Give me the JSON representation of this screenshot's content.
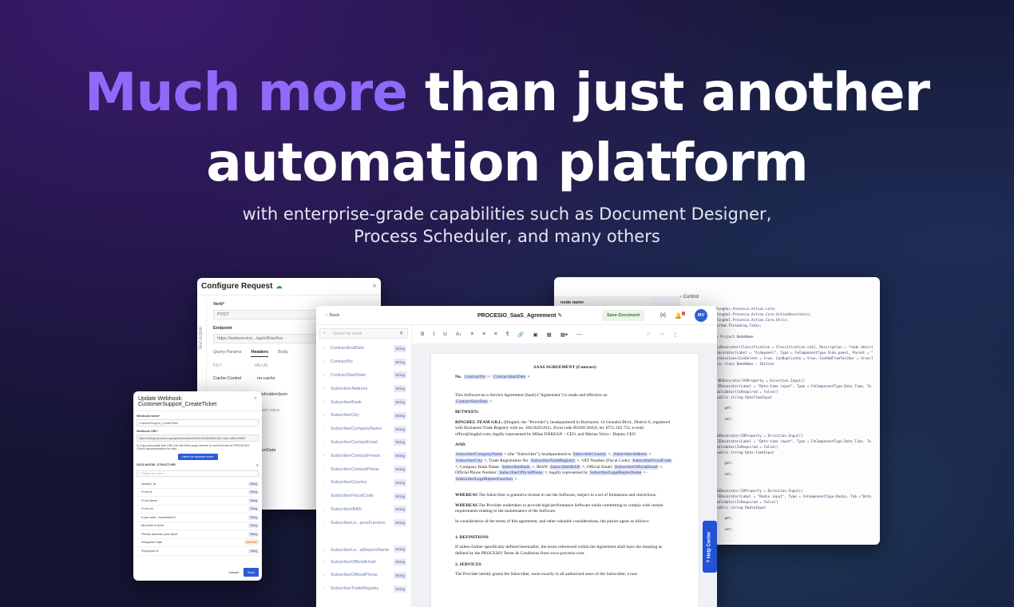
{
  "hero": {
    "headline_accent": "Much more",
    "headline_rest": " than just another",
    "headline_line2": "automation platform",
    "sub_line1": "with enterprise-grade capabilities such as Document Designer,",
    "sub_line2": "Process Scheduler, and many others"
  },
  "colors": {
    "accent": "#8f6af8",
    "primary_button": "#2a5bd7",
    "background": "#141532"
  },
  "configure_request": {
    "title": "Configure Request",
    "close": "×",
    "side_label": "Test Action",
    "verb_label": "Verb*",
    "verb_value": "POST",
    "endpoint_label": "Endpoint",
    "endpoint_value": "https://webservice.../api/v8/ws/tva",
    "tabs": [
      "Query Params",
      "Headers",
      "Body"
    ],
    "col_key": "KEY",
    "col_value": "VALUE",
    "rows": [
      {
        "key": "Cache-Control",
        "value": "no-cache"
      },
      {
        "key": "",
        "value": "application/json"
      },
      {
        "key": "",
        "value": "Insert value"
      },
      {
        "key": "",
        "value": "ationDate"
      }
    ]
  },
  "webhook": {
    "title": "Update Webhook: CustomerSupport_CreateTicket",
    "close": "×",
    "name_label": "Webhook name*",
    "name_value": "CustomerSupport_CreateTicket",
    "url_label": "Webhook URL*",
    "url_value": "https://webapi.procesio.app/api/webhooks/client/b7bc28f1f5d9-f4d1-4a4c-b8bd-f2ffd87",
    "note": "Copy and paste this URL into the third-party service to send events to PROCESIO. Check documentation for help",
    "listen_button": "Listen for another event",
    "structure_label": "DATA MODEL STRUCTURE",
    "search_placeholder": "Search by name",
    "fields": [
      {
        "name": "created_at",
        "type": "String"
      },
      {
        "name": "From Id",
        "type": "String"
      },
      {
        "name": "From Name",
        "type": "String"
      },
      {
        "name": "From Url",
        "type": "String"
      },
      {
        "name": "If you want...experiment it",
        "type": "String"
      },
      {
        "name": "My ticket is done",
        "type": "String"
      },
      {
        "name": "Please describe your ticket",
        "type": "String"
      },
      {
        "name": "Response Date",
        "type": "DateTime"
      },
      {
        "name": "Response Id",
        "type": "String"
      }
    ],
    "cancel": "Cancel",
    "save": "Save"
  },
  "code_window": {
    "control_tab": "Control",
    "node_name_header": "node name",
    "lines": [
      "Ringhel.Procesio.Action.Core;",
      "Ringhel.Procesio.Action.Core.ActionDecorators;",
      "Ringhel.Procesio.Action.Core.Utils;",
      "ystem.Threading.Tasks;",
      "",
      "e Project.NodeName",
      "",
      "ssDecorator(Classification = Classification.cat1, Description = \"node descri",
      "Decorator(Label = \"Sidepanel\", Type = FeComponentType.Side_panel, Parent = \"",
      "ermissions(CanDelete = true, CanDuplicate = true, CanAddFromToolbar = true)]",
      "lic class NodeName : IAction",
      "",
      "",
      "FBEDecorator(IOProperty = Direction.Input)]",
      "FEDecorator(Label = \"Date-time input\", Type = FeComponentType.Date_Time, Ta",
      "Validator(IsRequired = false)]",
      "public string DateTimeInput",
      "",
      "    get;",
      "",
      "    set;",
      "",
      "",
      "BEDecorator(IOProperty = Direction.Input)]",
      "FEDecorator(Label = \"Date-time input\", Type = FeComponentType.Date_Time, Ta",
      "Validator(IsRequired = false)]",
      "public string Date-timeInput",
      "",
      "    get;",
      "",
      "    set;",
      "",
      "",
      "BEDecorator(IOProperty = Direction.Input)]",
      "FEDecorator(Label = \"Radio input\", Type = FeComponentType.Radio, Tab =\"Deta",
      "Validator(IsRequired = false)]",
      "public string RadioInput",
      "",
      "    get;",
      "",
      "    set;"
    ]
  },
  "help_center": "Help Center",
  "document": {
    "back": "Back",
    "name": "PROCESIO_SaaS_Agreement",
    "save": "Save Document",
    "fx": "{x}",
    "badge": "1",
    "avatar": "MV",
    "search_placeholder": "Search by name",
    "variables": [
      {
        "name": "ContractEndDate",
        "type": "String"
      },
      {
        "name": "ContractNo",
        "type": "String"
      },
      {
        "name": "ContractStartDate",
        "type": "String"
      },
      {
        "name": "SubscriberAddress",
        "type": "String"
      },
      {
        "name": "SubscriberBank",
        "type": "String"
      },
      {
        "name": "SubscriberCity",
        "type": "String"
      },
      {
        "name": "SubscriberCompanyName",
        "type": "String"
      },
      {
        "name": "SubscriberContactEmail",
        "type": "String"
      },
      {
        "name": "SubscriberContactPerson",
        "type": "String"
      },
      {
        "name": "SubscriberContactPhone",
        "type": "String"
      },
      {
        "name": "SubscriberCountry",
        "type": "String"
      },
      {
        "name": "SubscriberFiscalCode",
        "type": "String"
      },
      {
        "name": "SubscriberIBAN",
        "type": "String"
      },
      {
        "name": "SubscriberLe...presFunction",
        "type": "String"
      },
      {
        "name": "SubscriberLe...alRepresName",
        "type": "String"
      },
      {
        "name": "SubscriberOfficialEmail",
        "type": "String"
      },
      {
        "name": "SubscriberOfficialPhone",
        "type": "String"
      },
      {
        "name": "SubscriberTradeRegistry",
        "type": "String"
      }
    ],
    "toolbar": [
      "B",
      "I",
      "U",
      "A↕",
      "≡",
      "≡",
      "≡",
      "¶",
      "🔗",
      "▣",
      "▦",
      "▦▾",
      "—",
      "↶",
      "↷",
      "⋮"
    ],
    "paper": {
      "heading": "SAAS AGREEMENT (Contract)",
      "no_label": "No.",
      "chip_contract_no": "ContractNo",
      "chip_start": "ContractStartDate",
      "intro": "This Software-as-a-Service Agreement (SaaS) (\"Agreement\") is made and effective on",
      "between": "BETWEEN:",
      "ringhel_bold": "RINGHEL TEAM S.R.L.",
      "ringhel_text": " (Ringhel, the \"Provider\"), headquartered in Bucharest, 14 Gentalui Blvd., District 6, registered with Bucharest Trade Registry with no. J40/2629/2011, fiscal code RO28139450, tel. 0755 262 752, e-mail: office@ringhel.com, legally represented by Mihai DĂRZAN – CEO, and Marian Voicu - Deputy CEO",
      "and": "AND:",
      "chip_company": "SubscriberCompanyName",
      "sub_text": " (the \"Subscriber\"), headquartered in ",
      "chip_country": "SubscriberCountry",
      "chip_address": "SubscriberAddress",
      "chip_city": "SubscriberCity",
      "trade_text": ", Trade Registration No: ",
      "chip_trade": "SubscriberTradeRegistry",
      "vat_text": ", VAT Number (Fiscal Code): ",
      "chip_fiscal": "SubscriberFiscalCode",
      "bank_text": ", Company Bank Name: ",
      "chip_bank": "SubscriberBank",
      "iban_text": ", IBAN: ",
      "chip_iban": "SubscriberIBAN",
      "email_text": ", Official Email: ",
      "chip_email": "SubscriberOfficialEmail",
      "phone_text": ", Official Phone Number: ",
      "chip_phone": "SubscriberOfficialPhone",
      "legal_text": ", legally represented by ",
      "chip_repname": "SubscriberLegalRepresName",
      "dash": " - ",
      "chip_repfunc": "SubscriberLegalRepresFunction",
      "whereas1_bold": "WHEREAS",
      "whereas1": " The Subscriber is granted a license to use the Software, subject to a set of limitations and restrictions.",
      "whereas2_bold": "WHEREAS",
      "whereas2": " The Provider undertakes to provide high-performance Software while committing to comply with certain requirements relating to the maintenance of the Software.",
      "consideration": "In consideration of the terms of this agreement, and other valuable considerations, the parties agree as follows:",
      "def_heading": "1.  DEFINITIONS",
      "def_text": "If unless further specifically defined hereinafter, the terms referenced within the Agreement shall have the meaning as defined by the PROCESIO Terms & Conditions from www.procesio.com.",
      "services_heading": "2.  SERVICES",
      "services_text": "The Provider hereby grants the Subscriber, more exactly to all authorized users of the Subscriber, a non-"
    }
  }
}
